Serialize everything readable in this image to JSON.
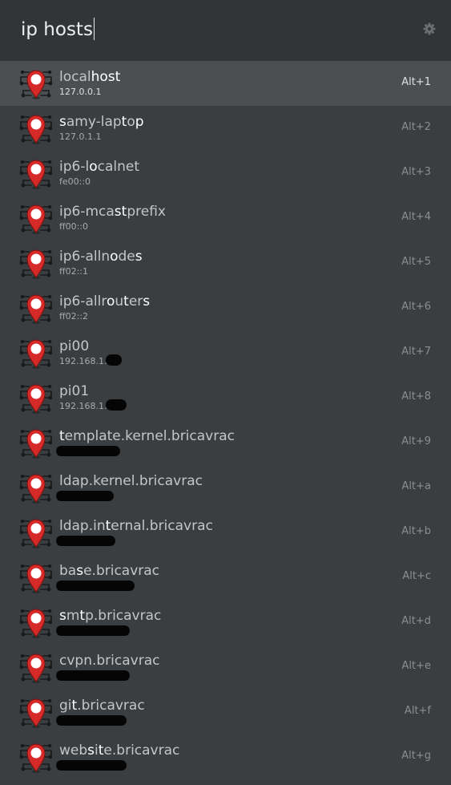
{
  "search": {
    "query": "ip hosts"
  },
  "icons": {
    "settings": "gear-icon",
    "result": "map-pin-icon",
    "accent": "#d42a2a"
  },
  "results": [
    {
      "name": "localhost",
      "segments": [
        {
          "t": "local",
          "m": false
        },
        {
          "t": "host",
          "m": true
        }
      ],
      "address": "127.0.0.1",
      "shortcut": "Alt+1",
      "selected": true
    },
    {
      "name": "samy-laptop",
      "segments": [
        {
          "t": "s",
          "m": true
        },
        {
          "t": "amy-lap",
          "m": false
        },
        {
          "t": "t",
          "m": true
        },
        {
          "t": "o",
          "m": false
        },
        {
          "t": "p",
          "m": true
        }
      ],
      "address": "127.0.1.1",
      "shortcut": "Alt+2"
    },
    {
      "name": "ip6-localnet",
      "segments": [
        {
          "t": "ip6-l",
          "m": false
        },
        {
          "t": "o",
          "m": true
        },
        {
          "t": "calnet",
          "m": false
        }
      ],
      "address": "fe00::0",
      "shortcut": "Alt+3"
    },
    {
      "name": "ip6-mcastprefix",
      "segments": [
        {
          "t": "ip6-mca",
          "m": false
        },
        {
          "t": "st",
          "m": true
        },
        {
          "t": "prefix",
          "m": false
        }
      ],
      "address": "ff00::0",
      "shortcut": "Alt+4"
    },
    {
      "name": "ip6-allnodes",
      "segments": [
        {
          "t": "ip6-alln",
          "m": false
        },
        {
          "t": "o",
          "m": true
        },
        {
          "t": "de",
          "m": false
        },
        {
          "t": "s",
          "m": true
        }
      ],
      "address": "ff02::1",
      "shortcut": "Alt+5"
    },
    {
      "name": "ip6-allrouters",
      "segments": [
        {
          "t": "ip6-allr",
          "m": false
        },
        {
          "t": "o",
          "m": true
        },
        {
          "t": "u",
          "m": false
        },
        {
          "t": "t",
          "m": true
        },
        {
          "t": "er",
          "m": false
        },
        {
          "t": "s",
          "m": true
        }
      ],
      "address": "ff02::2",
      "shortcut": "Alt+6"
    },
    {
      "name": "pi00",
      "segments": [
        {
          "t": "pi00",
          "m": false
        }
      ],
      "address": "192.168.1.",
      "shortcut": "Alt+7"
    },
    {
      "name": "pi01",
      "segments": [
        {
          "t": "pi01",
          "m": false
        }
      ],
      "address": "192.168.1.",
      "shortcut": "Alt+8"
    },
    {
      "name": "template.kernel.bricavrac",
      "segments": [
        {
          "t": "t",
          "m": true
        },
        {
          "t": "emplate.kernel.bricavrac",
          "m": false
        }
      ],
      "address": "",
      "shortcut": "Alt+9"
    },
    {
      "name": "ldap.kernel.bricavrac",
      "segments": [
        {
          "t": "ldap.kernel.bricavrac",
          "m": false
        }
      ],
      "address": "",
      "shortcut": "Alt+a"
    },
    {
      "name": "ldap.internal.bricavrac",
      "segments": [
        {
          "t": "ldap.in",
          "m": false
        },
        {
          "t": "t",
          "m": true
        },
        {
          "t": "ernal.bricavrac",
          "m": false
        }
      ],
      "address": "",
      "shortcut": "Alt+b"
    },
    {
      "name": "base.bricavrac",
      "segments": [
        {
          "t": "ba",
          "m": false
        },
        {
          "t": "s",
          "m": true
        },
        {
          "t": "e.bricavrac",
          "m": false
        }
      ],
      "address": "",
      "shortcut": "Alt+c"
    },
    {
      "name": "smtp.bricavrac",
      "segments": [
        {
          "t": "s",
          "m": true
        },
        {
          "t": "m",
          "m": false
        },
        {
          "t": "t",
          "m": true
        },
        {
          "t": "p.bricavrac",
          "m": false
        }
      ],
      "address": "",
      "shortcut": "Alt+d"
    },
    {
      "name": "cvpn.bricavrac",
      "segments": [
        {
          "t": "cvpn.bricavrac",
          "m": false
        }
      ],
      "address": "",
      "shortcut": "Alt+e"
    },
    {
      "name": "git.bricavrac",
      "segments": [
        {
          "t": "gi",
          "m": false
        },
        {
          "t": "t",
          "m": true
        },
        {
          "t": ".bricavrac",
          "m": false
        }
      ],
      "address": "",
      "shortcut": "Alt+f"
    },
    {
      "name": "website.bricavrac",
      "segments": [
        {
          "t": "web",
          "m": false
        },
        {
          "t": "s",
          "m": true
        },
        {
          "t": "i",
          "m": false
        },
        {
          "t": "t",
          "m": true
        },
        {
          "t": "e.bricavrac",
          "m": false
        }
      ],
      "address": "",
      "shortcut": "Alt+g"
    }
  ]
}
